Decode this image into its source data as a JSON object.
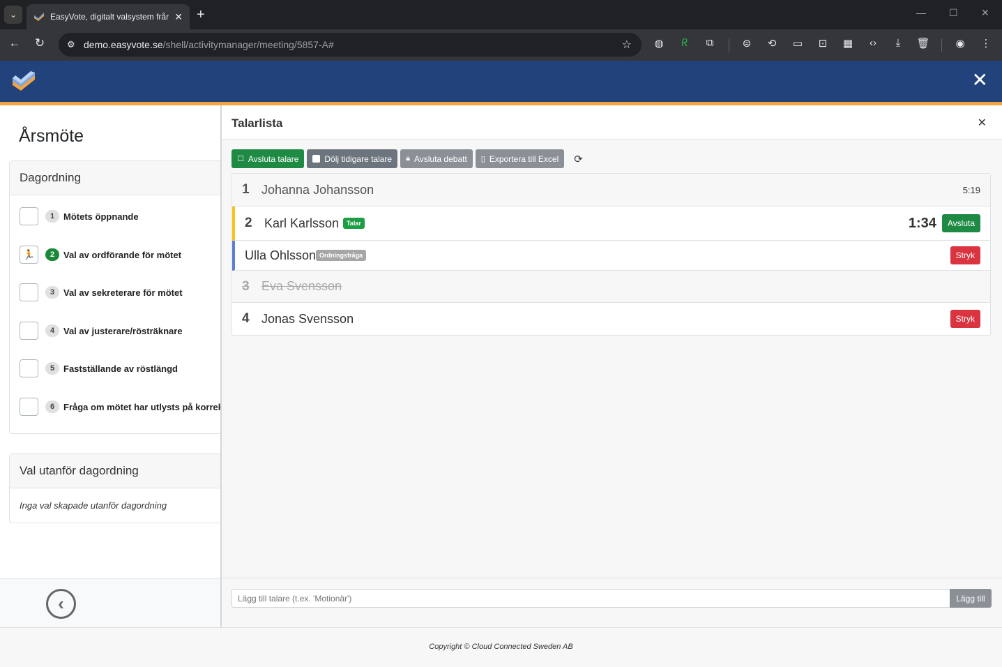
{
  "browser": {
    "tab_title": "EasyVote, digitalt valsystem från",
    "url_host": "demo.easyvote.se",
    "url_path": "/shell/activitymanager/meeting/5857-A#"
  },
  "app": {
    "brand_color": "#21427b",
    "accent_color": "#f2a444"
  },
  "sidebar": {
    "meeting_title": "Årsmöte",
    "agenda_header": "Dagordning",
    "agenda_items": [
      {
        "num": "1",
        "label": "Mötets öppnande",
        "active": false
      },
      {
        "num": "2",
        "label": "Val av ordförande för mötet",
        "active": true
      },
      {
        "num": "3",
        "label": "Val av sekreterare för mötet",
        "active": false
      },
      {
        "num": "4",
        "label": "Val av justerare/rösträknare",
        "active": false
      },
      {
        "num": "5",
        "label": "Fastställande av röstlängd",
        "active": false
      },
      {
        "num": "6",
        "label": "Fråga om mötet har utlysts på korrekt",
        "active": false
      }
    ],
    "other_votes_header": "Val utanför dagordning",
    "other_votes_empty": "Inga val skapade utanför dagordning"
  },
  "speakers_panel": {
    "title": "Talarlista",
    "buttons": {
      "end_speaker": "Avsluta talare",
      "hide_previous": "Dölj tidigare talare",
      "end_debate": "Avsluta debatt",
      "export_excel": "Exportera till Excel"
    },
    "speakers": [
      {
        "num": "1",
        "name": "Johanna Johansson",
        "time": "5:19",
        "state": "done"
      },
      {
        "num": "2",
        "name": "Karl Karlsson",
        "badge": "Talar",
        "time": "1:34",
        "action": "Avsluta",
        "state": "speaking"
      },
      {
        "num": "",
        "name": "Ulla Ohlsson",
        "badge": "Ordningsfråga",
        "action": "Stryk",
        "state": "point-of-order"
      },
      {
        "num": "3",
        "name": "Eva Svensson",
        "state": "struck"
      },
      {
        "num": "4",
        "name": "Jonas Svensson",
        "action": "Stryk",
        "state": "waiting"
      }
    ],
    "add_placeholder": "Lägg till talare (t.ex. 'Motionär')",
    "add_button": "Lägg till"
  },
  "footer": {
    "copyright": "Copyright © Cloud Connected Sweden AB"
  }
}
